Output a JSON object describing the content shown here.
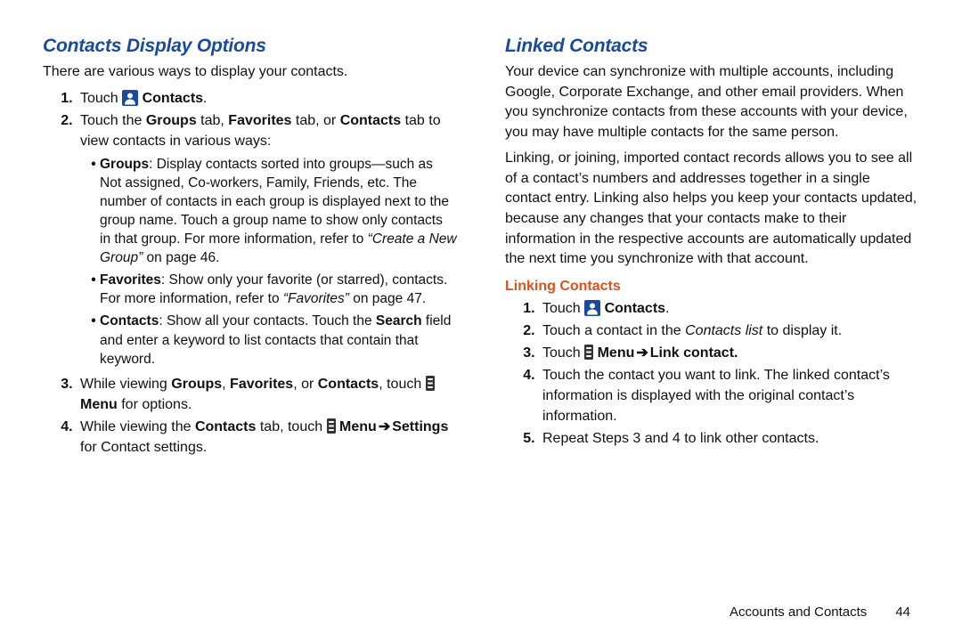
{
  "left": {
    "heading": "Contacts Display Options",
    "intro": "There are various ways to display your contacts.",
    "steps": {
      "s1_a": "Touch ",
      "s1_b": "Contacts",
      "s1_c": ".",
      "s2_a": "Touch the ",
      "s2_b": "Groups",
      "s2_c": " tab, ",
      "s2_d": "Favorites",
      "s2_e": " tab, or ",
      "s2_f": "Contacts",
      "s2_g": " tab to view contacts in various ways:",
      "bullets": {
        "b1_a": "Groups",
        "b1_b": ": Display contacts sorted into groups—such as Not assigned, Co-workers, Family, Friends, etc. The number of contacts in each group is displayed next to the group name. Touch a group name to show only contacts in that group. For more information, refer to ",
        "b1_c": "“Create a New Group”",
        "b1_d": " on page 46.",
        "b2_a": "Favorites",
        "b2_b": ": Show only your favorite (or starred), contacts. For more information, refer to ",
        "b2_c": "“Favorites”",
        "b2_d": " on page 47.",
        "b3_a": "Contacts",
        "b3_b": ": Show all your contacts. Touch the ",
        "b3_c": "Search",
        "b3_d": " field and enter a keyword to list contacts that contain that keyword."
      },
      "s3_a": "While viewing ",
      "s3_b": "Groups",
      "s3_c": ", ",
      "s3_d": "Favorites",
      "s3_e": ", or ",
      "s3_f": "Contacts",
      "s3_g": ", touch ",
      "s3_h": "Menu",
      "s3_i": " for options.",
      "s4_a": "While viewing the ",
      "s4_b": "Contacts",
      "s4_c": " tab, touch ",
      "s4_d": "Menu",
      "s4_e": "Settings",
      "s4_f": " for Contact settings."
    }
  },
  "right": {
    "heading": "Linked Contacts",
    "p1": "Your device can synchronize with multiple accounts, including Google, Corporate Exchange, and other email providers. When you synchronize contacts from these accounts with your device, you may have multiple contacts for the same person.",
    "p2": "Linking, or joining, imported contact records allows you to see all of a contact’s numbers and addresses together in a single contact entry. Linking also helps you keep your contacts updated, because any changes that your contacts make to their information in the respective accounts are automatically updated the next time you synchronize with that account.",
    "subheading": "Linking Contacts",
    "steps": {
      "s1_a": "Touch ",
      "s1_b": "Contacts",
      "s1_c": ".",
      "s2_a": "Touch a contact in the ",
      "s2_b": "Contacts list",
      "s2_c": " to display it.",
      "s3_a": "Touch ",
      "s3_b": "Menu",
      "s3_c": "Link contact.",
      "s4": "Touch the contact you want to link. The linked contact’s information is displayed with the original contact’s information.",
      "s5": "Repeat Steps 3 and 4 to link other contacts."
    }
  },
  "footer": {
    "section": "Accounts and Contacts",
    "page": "44"
  },
  "arrow": "➔"
}
